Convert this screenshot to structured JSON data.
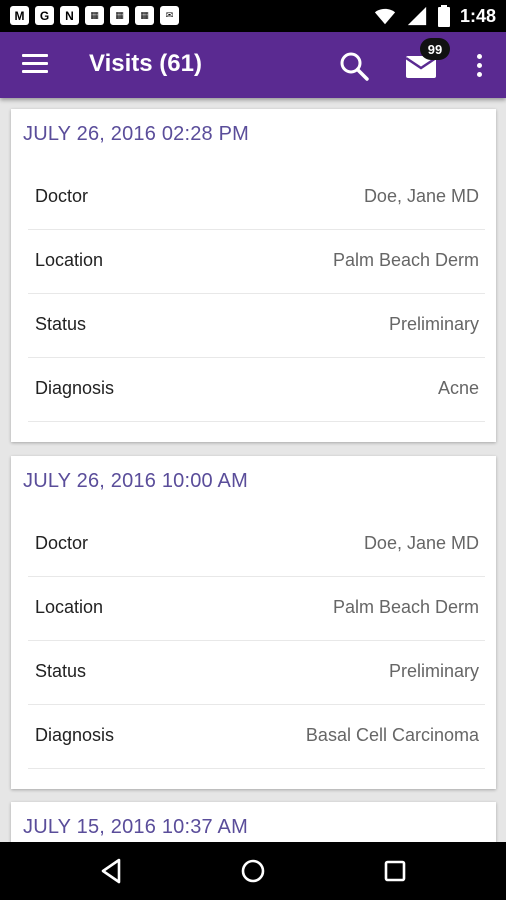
{
  "status_bar": {
    "time": "1:48",
    "notification_icons": [
      "gmail-icon",
      "google-icon",
      "n-icon",
      "calendar-icon",
      "calendar-icon",
      "calendar-icon",
      "news-icon"
    ],
    "notification_glyphs": [
      "M",
      "G",
      "N",
      "",
      "",
      "",
      ""
    ]
  },
  "app_bar": {
    "title": "Visits (61)",
    "mail_badge": "99",
    "accent_color": "#5a2a91"
  },
  "visits": [
    {
      "date": "JULY 26, 2016 02:28 PM",
      "fields": [
        {
          "label": "Doctor",
          "value": "Doe, Jane MD"
        },
        {
          "label": "Location",
          "value": "Palm Beach Derm"
        },
        {
          "label": "Status",
          "value": "Preliminary"
        },
        {
          "label": "Diagnosis",
          "value": "Acne"
        }
      ]
    },
    {
      "date": "JULY 26, 2016 10:00 AM",
      "fields": [
        {
          "label": "Doctor",
          "value": "Doe, Jane MD"
        },
        {
          "label": "Location",
          "value": "Palm Beach Derm"
        },
        {
          "label": "Status",
          "value": "Preliminary"
        },
        {
          "label": "Diagnosis",
          "value": "Basal Cell Carcinoma"
        }
      ]
    },
    {
      "date": "JULY 15, 2016 10:37 AM",
      "fields": []
    }
  ]
}
